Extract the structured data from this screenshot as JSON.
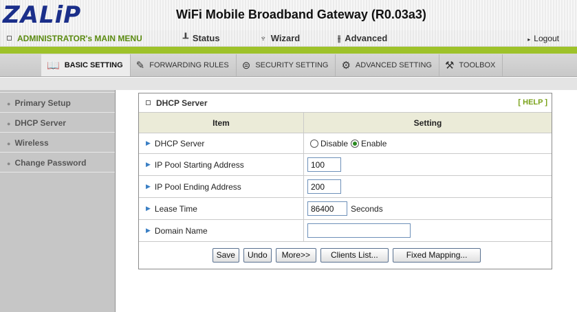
{
  "header": {
    "logo": "ZALiP",
    "title": "WiFi Mobile Broadband Gateway (R0.03a3)"
  },
  "main_menu": {
    "admin_label": "ADMINISTRATOR's MAIN MENU",
    "items": [
      {
        "label": "Status",
        "icon": "status-icon"
      },
      {
        "label": "Wizard",
        "icon": "wizard-icon"
      },
      {
        "label": "Advanced",
        "icon": "advanced-icon"
      }
    ],
    "logout_label": "Logout"
  },
  "tabs": [
    {
      "label": "BASIC SETTING",
      "icon": "basic-setting-icon",
      "active": true
    },
    {
      "label": "FORWARDING RULES",
      "icon": "forwarding-rules-icon"
    },
    {
      "label": "SECURITY SETTING",
      "icon": "security-setting-icon"
    },
    {
      "label": "ADVANCED SETTING",
      "icon": "advanced-setting-icon"
    },
    {
      "label": "TOOLBOX",
      "icon": "toolbox-icon"
    }
  ],
  "sidebar": {
    "items": [
      {
        "label": "Primary Setup"
      },
      {
        "label": "DHCP Server"
      },
      {
        "label": "Wireless"
      },
      {
        "label": "Change Password"
      }
    ]
  },
  "panel": {
    "title": "DHCP Server",
    "help_label": "[ HELP ]",
    "col_item": "Item",
    "col_setting": "Setting",
    "dhcp_server": {
      "label": "DHCP Server",
      "disable_label": "Disable",
      "enable_label": "Enable",
      "selected": "Enable"
    },
    "pool_start": {
      "label": "IP Pool Starting Address",
      "value": "100"
    },
    "pool_end": {
      "label": "IP Pool Ending Address",
      "value": "200"
    },
    "lease": {
      "label": "Lease Time",
      "value": "86400",
      "unit": "Seconds"
    },
    "domain": {
      "label": "Domain Name",
      "value": ""
    },
    "buttons": {
      "save": "Save",
      "undo": "Undo",
      "more": "More>>",
      "clients": "Clients List...",
      "fixed": "Fixed Mapping..."
    }
  },
  "colors": {
    "accent_green": "#9ec22a",
    "logo_blue": "#1b2f8a",
    "admin_green": "#5a8a10",
    "table_header": "#ebebd8",
    "sidebar_bg": "#c6c6c6"
  }
}
